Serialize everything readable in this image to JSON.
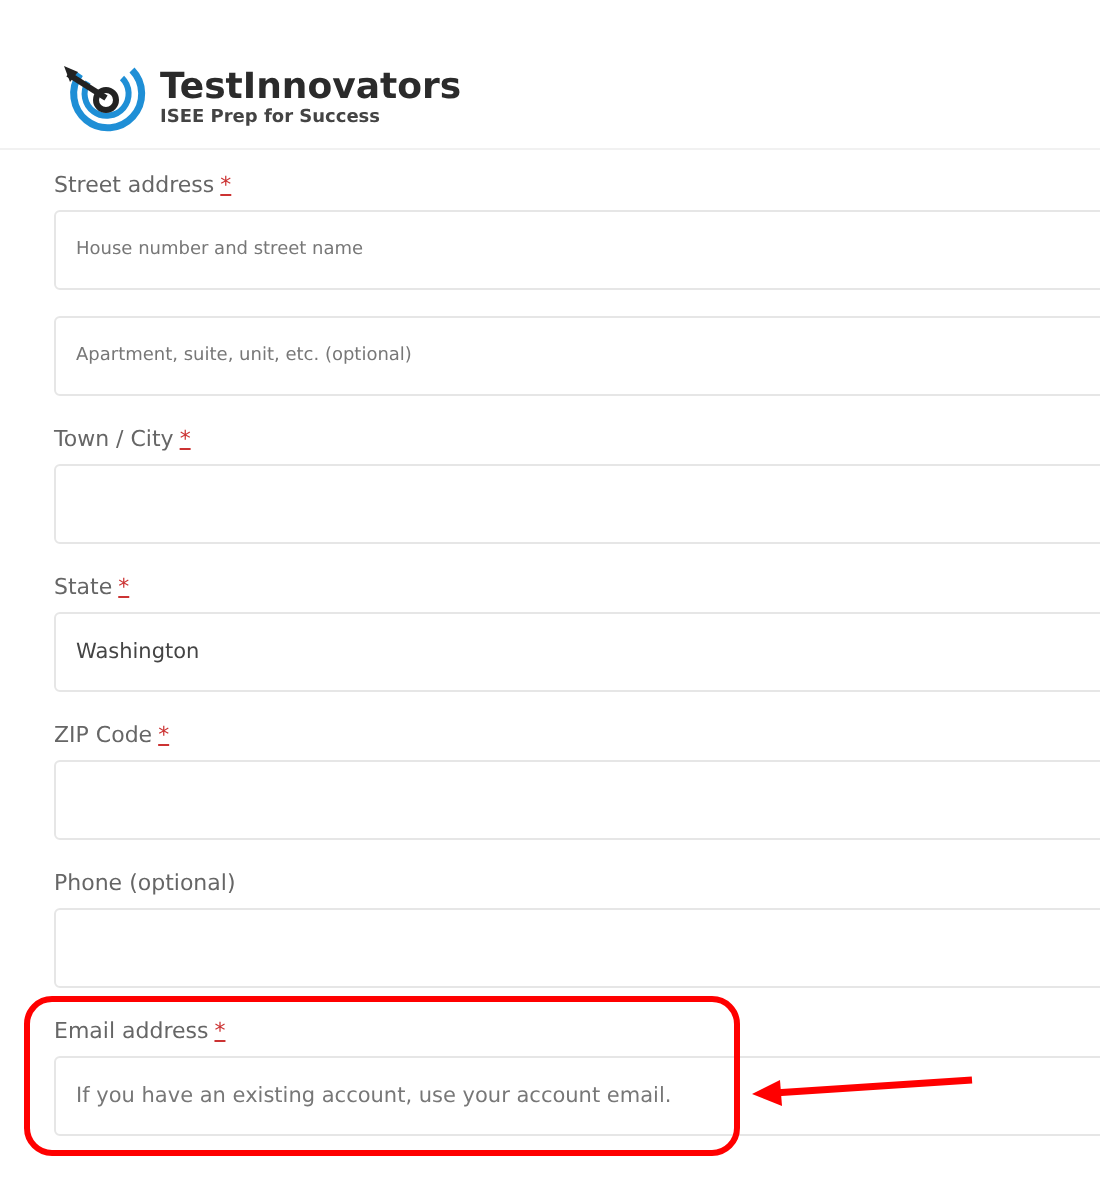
{
  "brand": {
    "name": "TestInnovators",
    "tagline": "ISEE Prep for Success"
  },
  "fields": [
    {
      "label": "Street address",
      "required_mark": "*",
      "highlighted": false,
      "inputs": [
        {
          "placeholder": "House number and street name",
          "kind": "compact"
        },
        {
          "placeholder": "Apartment, suite, unit, etc. (optional)",
          "kind": "compact"
        }
      ]
    },
    {
      "label": "Town / City",
      "required_mark": "*",
      "highlighted": false,
      "inputs": [
        {
          "kind": "blank"
        }
      ]
    },
    {
      "label": "State",
      "required_mark": "*",
      "highlighted": false,
      "inputs": [
        {
          "value": "Washington",
          "kind": "standard"
        }
      ]
    },
    {
      "label": "ZIP Code",
      "required_mark": "*",
      "highlighted": false,
      "inputs": [
        {
          "kind": "blank"
        }
      ]
    },
    {
      "label": "Phone (optional)",
      "highlighted": false,
      "inputs": [
        {
          "kind": "blank"
        }
      ]
    },
    {
      "label": "Email address",
      "required_mark": "*",
      "highlighted": true,
      "inputs": [
        {
          "placeholder": "If you have an existing account, use your account email.",
          "kind": "standard"
        }
      ]
    }
  ]
}
